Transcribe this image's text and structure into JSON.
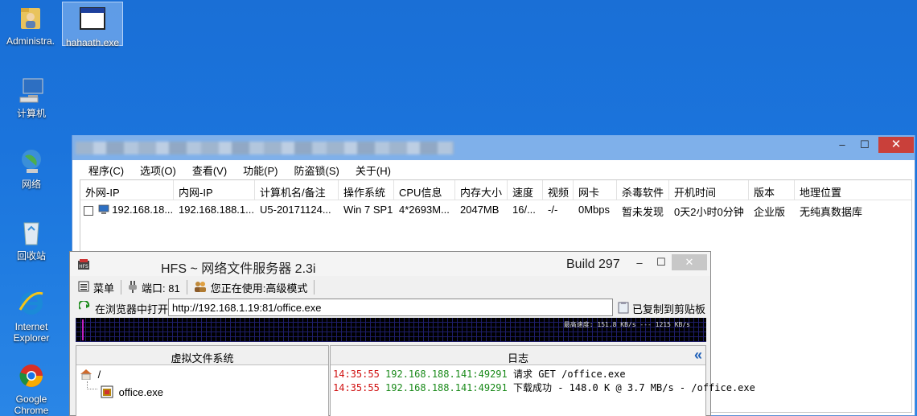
{
  "desktop": {
    "icons": [
      {
        "label": "Administra.",
        "icon": "folder-user-icon"
      },
      {
        "label": "hahaath.exe",
        "icon": "exe-window-icon"
      },
      {
        "label": "计算机",
        "icon": "computer-icon"
      },
      {
        "label": "网络",
        "icon": "network-globe-icon"
      },
      {
        "label": "回收站",
        "icon": "recycle-bin-icon"
      },
      {
        "label": "Internet Explorer",
        "icon": "ie-icon"
      },
      {
        "label": "Google Chrome",
        "icon": "chrome-icon"
      }
    ]
  },
  "main_window": {
    "controls": {
      "minimize": "–",
      "maximize": "☐",
      "close": "✕"
    },
    "menu": [
      "程序(C)",
      "选项(O)",
      "查看(V)",
      "功能(P)",
      "防盗锁(S)",
      "关于(H)"
    ],
    "columns": [
      "外网-IP",
      "内网-IP",
      "计算机名/备注",
      "操作系统",
      "CPU信息",
      "内存大小",
      "速度",
      "视频",
      "网卡",
      "杀毒软件",
      "开机时间",
      "版本",
      "地理位置"
    ],
    "rows": [
      [
        "192.168.18...",
        "192.168.188.1...",
        "U5-20171124...",
        "Win 7 SP1",
        "4*2693M...",
        "2047MB",
        "16/...",
        "-/-",
        "0Mbps",
        "暂未发现",
        "0天2小时0分钟",
        "企业版",
        "无纯真数据库"
      ]
    ]
  },
  "hfs": {
    "title": "HFS ~ 网络文件服务器 2.3i",
    "build": "Build 297",
    "controls": {
      "minimize": "–",
      "maximize": "☐",
      "close": "✕"
    },
    "toolbar": {
      "menu": "菜单",
      "port": "端口: 81",
      "mode": "您正在使用:高级模式"
    },
    "open_in_browser": "在浏览器中打开",
    "url": "http://192.168.1.19:81/office.exe",
    "copied": "已复制到剪贴板",
    "speed_text": "最高速度: 151.8 KB/s --- 1215 KB/s",
    "vfs_header": "虚拟文件系统",
    "vfs_root": "/",
    "vfs_file": "office.exe",
    "log_header": "日志",
    "log_collapse": "«",
    "log": [
      {
        "time": "14:35:55",
        "ip": "192.168.188.141:49291",
        "text": "请求 GET /office.exe"
      },
      {
        "time": "14:35:55",
        "ip": "192.168.188.141:49291",
        "text": "下载成功 - 148.0 K @ 3.7 MB/s - /office.exe"
      }
    ]
  }
}
